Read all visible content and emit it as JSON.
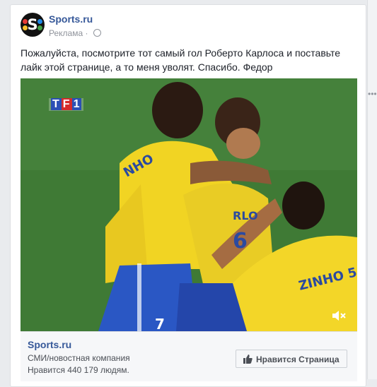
{
  "post": {
    "page_name": "Sports.ru",
    "sponsored_label": "Реклама",
    "separator": "·",
    "text": "Пожалуйста, посмотрите тот самый гол Роберто Карлоса и поставьте лайк этой странице, а то меня уволят. Спасибо. Федор"
  },
  "video": {
    "broadcaster_logo": "TF1",
    "mute_icon": "speaker-muted-icon"
  },
  "footer": {
    "page_name": "Sports.ru",
    "category": "СМИ/новостная компания",
    "likes": "Нравится 440 179 людям.",
    "like_button_label": "Нравится Страница"
  },
  "colors": {
    "link_blue": "#365899",
    "jersey_yellow": "#f1d423",
    "shorts_blue": "#2a57c4",
    "pitch_green": "#3f7a35"
  }
}
